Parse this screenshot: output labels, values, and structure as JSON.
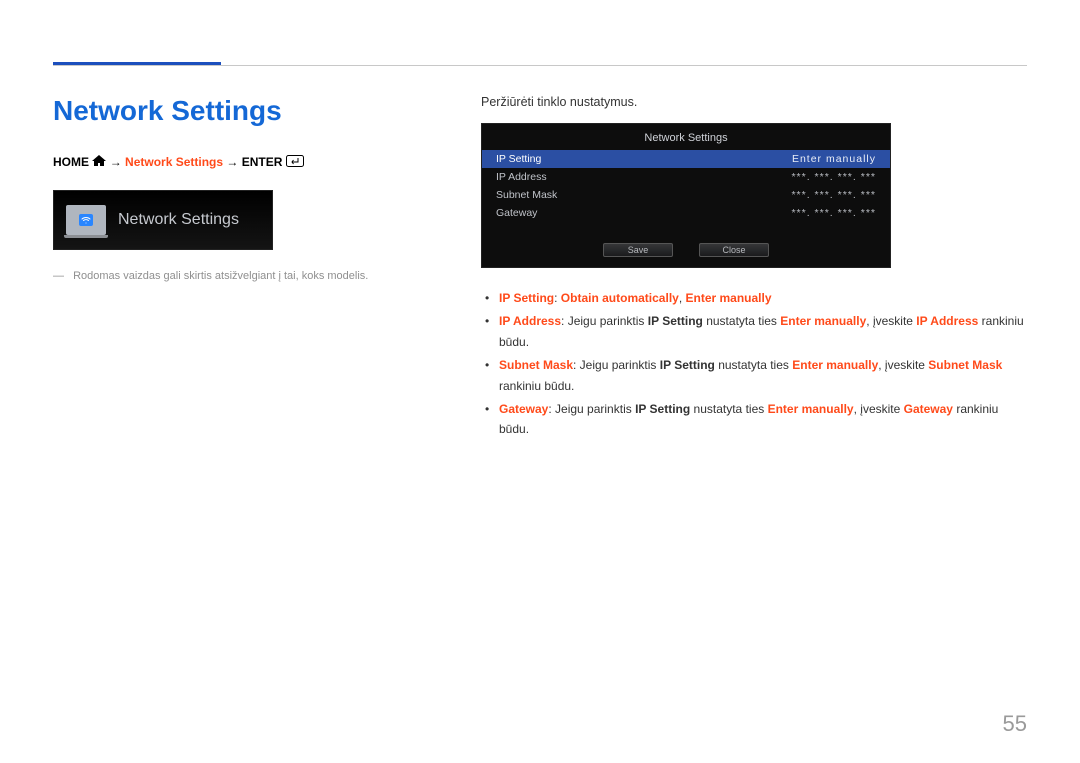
{
  "header": {
    "page_title": "Network Settings"
  },
  "breadcrumb": {
    "home": "HOME",
    "arrow": "→",
    "network_settings": "Network Settings",
    "enter": "ENTER"
  },
  "small_screenshot": {
    "title": "Network Settings"
  },
  "note": {
    "dash": "―",
    "text": "Rodomas vaizdas gali skirtis atsižvelgiant į tai, koks modelis."
  },
  "right": {
    "intro": "Peržiūrėti tinklo nustatymus.",
    "osd": {
      "title": "Network Settings",
      "rows": [
        {
          "label": "IP Setting",
          "value": "Enter manually"
        },
        {
          "label": "IP Address",
          "value": "***. ***. ***. ***"
        },
        {
          "label": "Subnet Mask",
          "value": "***. ***. ***. ***"
        },
        {
          "label": "Gateway",
          "value": "***. ***. ***. ***"
        }
      ],
      "buttons": {
        "save": "Save",
        "close": "Close"
      }
    },
    "bullets": {
      "b1": {
        "t1": "IP Setting",
        "t2": ": ",
        "t3": "Obtain automatically",
        "t4": ", ",
        "t5": "Enter manually"
      },
      "b2": {
        "t1": "IP Address",
        "t2": ": Jeigu parinktis ",
        "t3": "IP Setting",
        "t4": " nustatyta ties ",
        "t5": "Enter manually",
        "t6": ", įveskite ",
        "t7": "IP Address",
        "t8": " rankiniu būdu."
      },
      "b3": {
        "t1": "Subnet Mask",
        "t2": ": Jeigu parinktis ",
        "t3": "IP Setting",
        "t4": " nustatyta ties ",
        "t5": "Enter manually",
        "t6": ", įveskite ",
        "t7": "Subnet Mask",
        "t8": " rankiniu būdu."
      },
      "b4": {
        "t1": "Gateway",
        "t2": ": Jeigu parinktis ",
        "t3": "IP Setting",
        "t4": " nustatyta ties ",
        "t5": "Enter manually",
        "t6": ", įveskite ",
        "t7": "Gateway",
        "t8": " rankiniu būdu."
      }
    }
  },
  "page_number": "55"
}
